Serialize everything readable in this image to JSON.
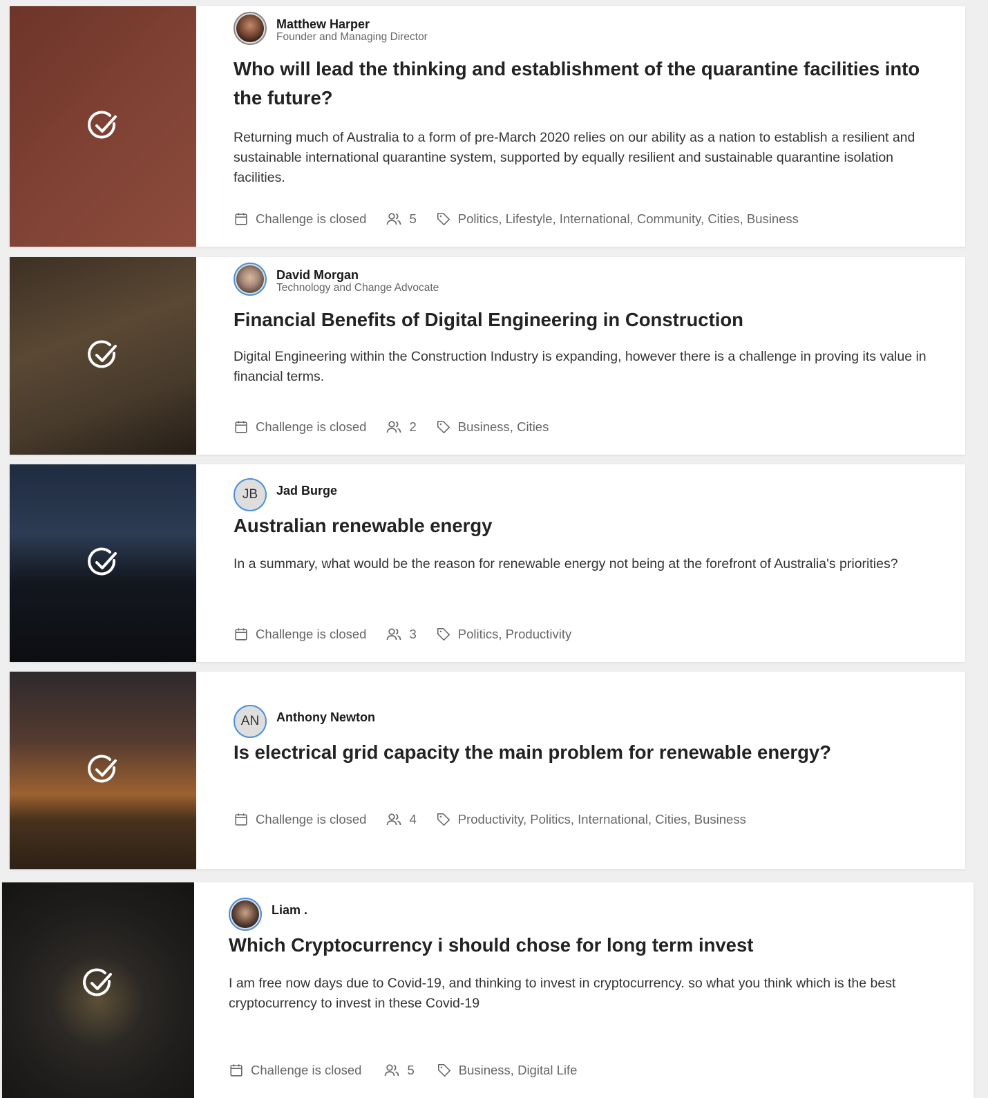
{
  "cards": [
    {
      "author": {
        "name": "Matthew Harper",
        "role": "Founder and Managing Director",
        "initials": ""
      },
      "title": "Who will lead the thinking and establishment of the quarantine facilities into the future?",
      "description": "Returning much of Australia to a form of pre-March 2020 relies on our ability as a nation to establish a resilient and sustainable international quarantine system, supported by equally resilient and sustainable quarantine isolation facilities.",
      "status": "Challenge is closed",
      "participants": "5",
      "tags": "Politics, Lifestyle, International, Community, Cities, Business"
    },
    {
      "author": {
        "name": "David Morgan",
        "role": "Technology and Change Advocate",
        "initials": ""
      },
      "title": "Financial Benefits of Digital Engineering in Construction",
      "description": "Digital Engineering within the Construction Industry is expanding, however there is a challenge in proving its value in financial terms.",
      "status": "Challenge is closed",
      "participants": "2",
      "tags": "Business, Cities"
    },
    {
      "author": {
        "name": "Jad Burge",
        "role": "",
        "initials": "JB"
      },
      "title": "Australian renewable energy",
      "description": "In a summary, what would be the reason for renewable energy not being at the forefront of Australia's priorities?",
      "status": "Challenge is closed",
      "participants": "3",
      "tags": "Politics, Productivity"
    },
    {
      "author": {
        "name": "Anthony Newton",
        "role": "",
        "initials": "AN"
      },
      "title": "Is electrical grid capacity the main problem for renewable energy?",
      "description": "",
      "status": "Challenge is closed",
      "participants": "4",
      "tags": "Productivity, Politics, International, Cities, Business"
    },
    {
      "author": {
        "name": "Liam .",
        "role": "",
        "initials": ""
      },
      "title": "Which Cryptocurrency i should chose for long term invest",
      "description": "I am free now days due to Covid-19, and thinking to invest in cryptocurrency. so what you think which is the best cryptocurrency to invest in these Covid-19",
      "status": "Challenge is closed",
      "participants": "5",
      "tags": "Business, Digital Life"
    }
  ],
  "colors": {
    "accent": "#4a90d9",
    "meta": "#666666"
  }
}
